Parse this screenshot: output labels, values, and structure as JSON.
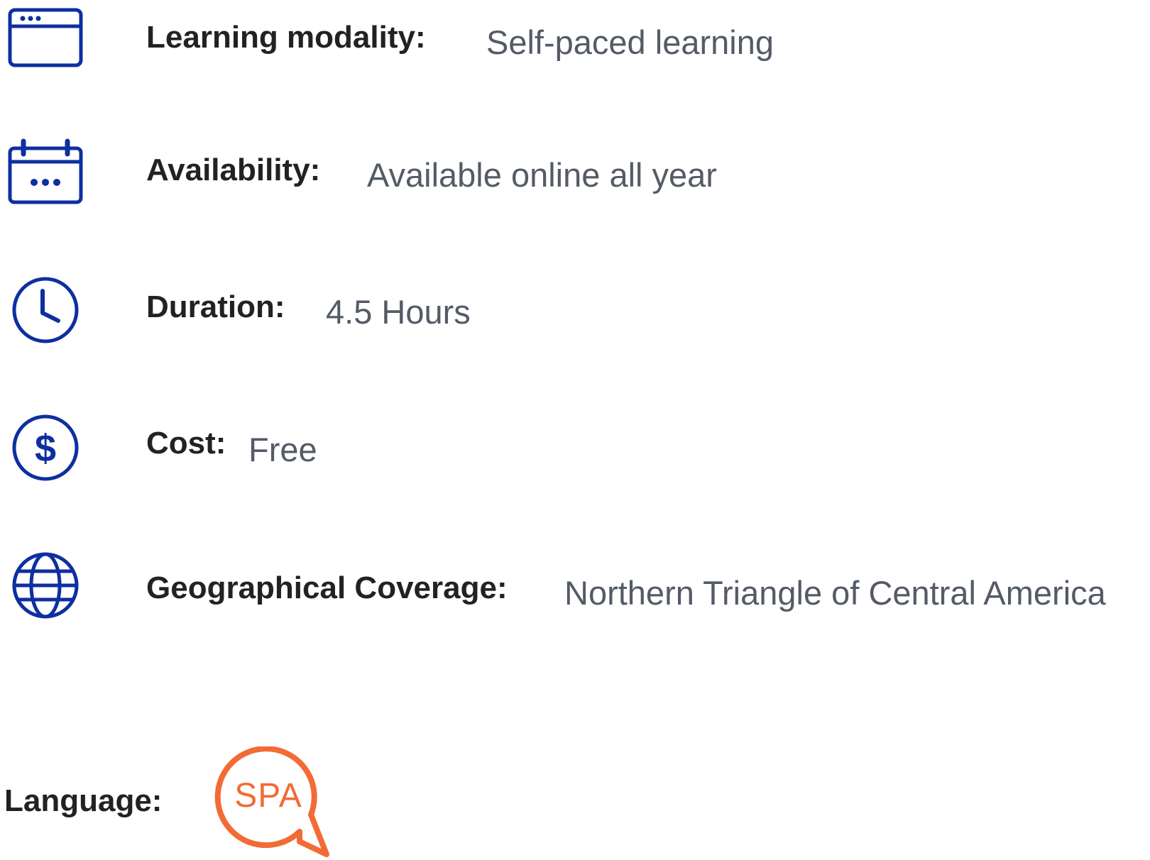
{
  "theme": {
    "icon_color": "#0e2fa0",
    "label_color": "#222222",
    "value_color": "#545b66",
    "badge_color": "#f26b35"
  },
  "details": [
    {
      "icon": "browser-window-icon",
      "label": "Learning modality:",
      "value": "Self-paced learning"
    },
    {
      "icon": "calendar-icon",
      "label": "Availability:",
      "value": "Available online all year"
    },
    {
      "icon": "clock-icon",
      "label": "Duration:",
      "value": "4.5 Hours"
    },
    {
      "icon": "dollar-icon",
      "label": "Cost:",
      "value": "Free"
    },
    {
      "icon": "globe-icon",
      "label": "Geographical Coverage:",
      "value": "Northern Triangle of Central America"
    }
  ],
  "language": {
    "label": "Language:",
    "icon": "speech-bubble-icon",
    "code": "SPA"
  }
}
